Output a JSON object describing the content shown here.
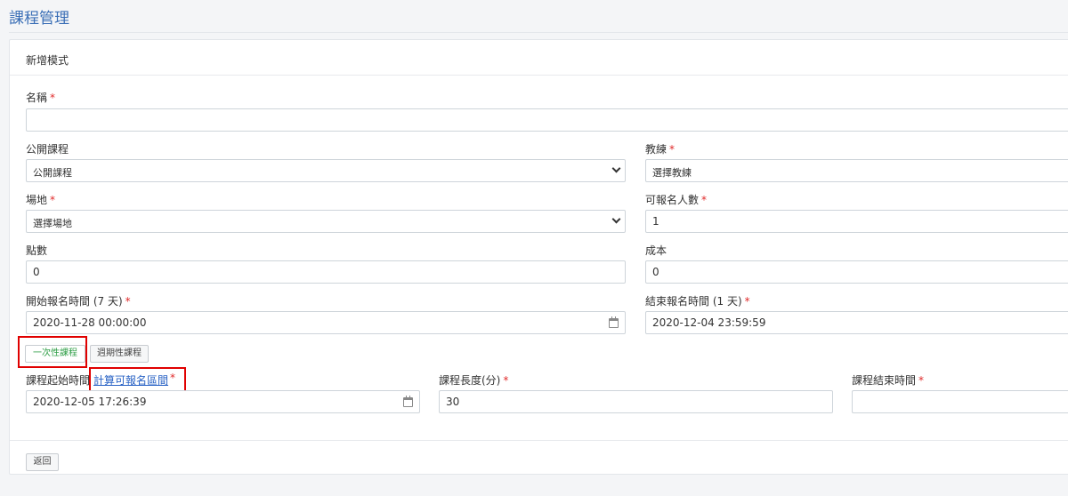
{
  "page": {
    "title": "課程管理"
  },
  "card": {
    "title": "新增模式"
  },
  "form": {
    "name": {
      "label": "名稱",
      "required": "*",
      "value": ""
    },
    "public": {
      "label": "公開課程",
      "value": "公開課程"
    },
    "coach": {
      "label": "教練",
      "required": "*",
      "value": "選擇教練"
    },
    "venue": {
      "label": "場地",
      "required": "*",
      "value": "選擇場地"
    },
    "capacity": {
      "label": "可報名人數",
      "required": "*",
      "value": "1"
    },
    "points": {
      "label": "點數",
      "value": "0"
    },
    "cost": {
      "label": "成本",
      "value": "0"
    },
    "reg_start": {
      "label": "開始報名時間 (7 天)",
      "required": "*",
      "value": "2020-11-28 00:00:00"
    },
    "reg_end": {
      "label": "結束報名時間 (1 天)",
      "required": "*",
      "value": "2020-12-04 23:59:59"
    },
    "mode_buttons": {
      "once": "一次性課程",
      "periodic": "週期性課程"
    },
    "course_start": {
      "label": "課程起始時間",
      "link": "計算可報名區間",
      "required": "*",
      "value": "2020-12-05 17:26:39"
    },
    "duration": {
      "label": "課程長度(分)",
      "required": "*",
      "value": "30"
    },
    "course_end": {
      "label": "課程結束時間",
      "required": "*",
      "value": ""
    }
  },
  "footer": {
    "back_label": "返回"
  },
  "icons": {
    "dropdown": "chevron-down-icon",
    "calendar": "calendar-icon"
  },
  "colors": {
    "title": "#3b6fb6",
    "required": "#e02b2b",
    "active_button": "#2e9e46",
    "highlight": "#e00000",
    "link": "#2a63c5"
  }
}
